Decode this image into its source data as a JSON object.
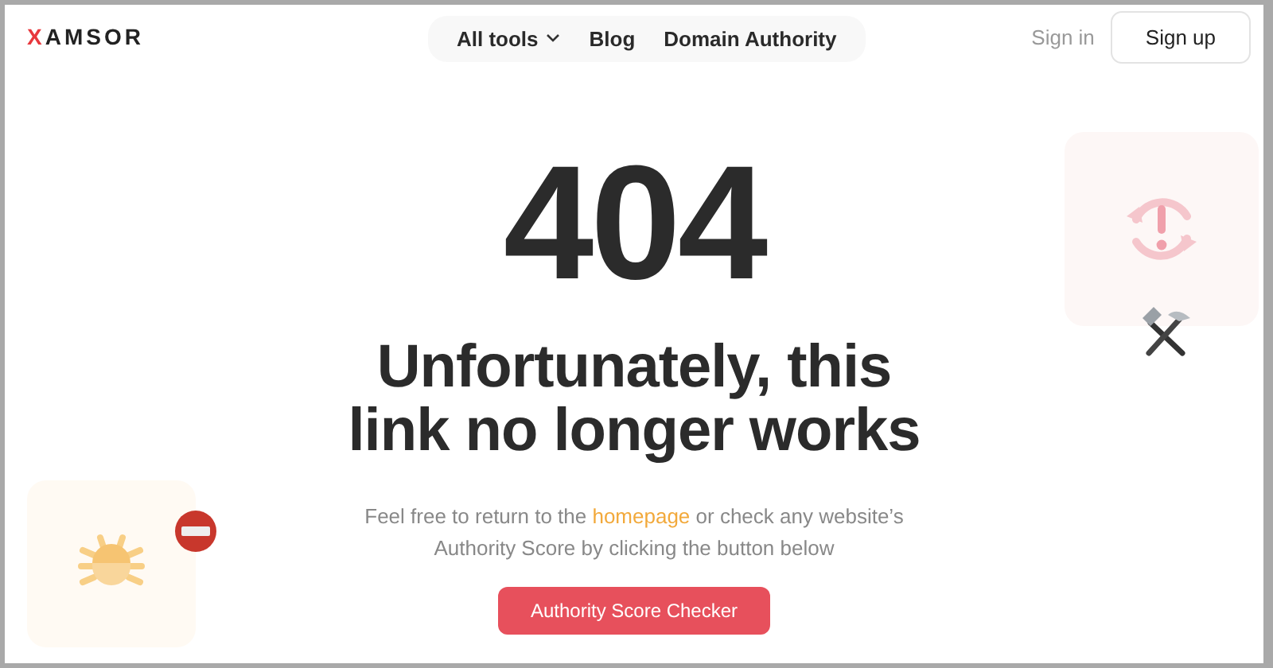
{
  "header": {
    "logo": "XAMSOR",
    "nav": [
      {
        "label": "All tools",
        "dropdown": true
      },
      {
        "label": "Blog",
        "dropdown": false
      },
      {
        "label": "Domain Authority",
        "dropdown": false
      }
    ],
    "sign_in": "Sign in",
    "sign_up": "Sign up"
  },
  "error": {
    "code": "404",
    "headline_lines": [
      "Unfortunately, this",
      "link no longer works"
    ],
    "message_before": "Feel free to return to the",
    "link": "homepage",
    "message_after": "or check any website’s Authority Score by clicking the button below",
    "button": "Authority Score Checker"
  }
}
